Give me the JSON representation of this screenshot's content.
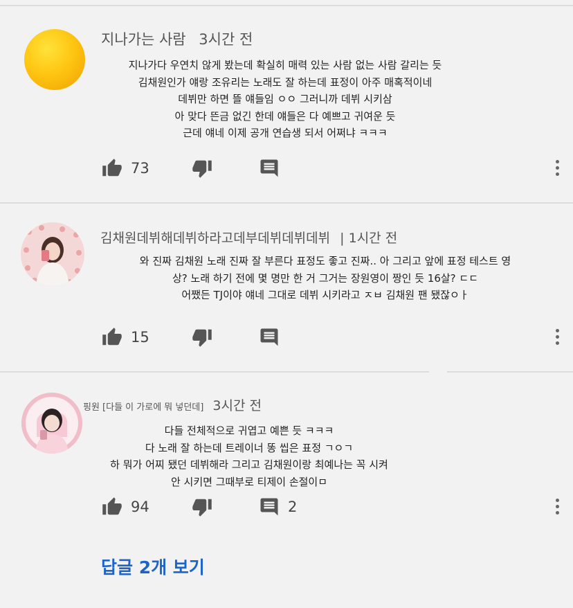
{
  "comments": [
    {
      "author": "지나가는 사람",
      "time": "3시간 전",
      "lines": [
        "지나가다 우연치 않게 봤는데 확실히 매력 있는 사람 없는 사람 갈리는 듯",
        "김채원인가 얘랑 조유리는 노래도 잘 하는데 표정이 아주 매혹적이네",
        "데뷔만 하면 뜰 얘들임 ㅇㅇ 그러니까 데뷔 시키삼",
        "아 맞다 뜬금 없긴 한데 얘들은 다 예쁘고 귀여운 듯",
        "근데 얘네 이제 공개 연습생 되서 어쩌냐 ㅋㅋㅋ"
      ],
      "likes": "73",
      "replies": "",
      "avatar": "yellow-circle-avatar"
    },
    {
      "author": "김채원데뷔해데뷔하라고데부데뷔데뷔데뷔",
      "time": "| 1시간 전",
      "lines": [
        "와 진짜 김채원 노래 진짜 잘 부른다 표정도 좋고 진짜.. 아 그리고 앞에 표정 테스트 영",
        "상? 노래 하기 전에 몇 명만 한 거 그거는 장원영이 짱인 듯 16살? ㄷㄷ",
        "어쨌든 TJ이야 얘네 그대로 데뷔 시키라고 ㅈㅂ 김채원 팬 됐잖ㅇㅏ"
      ],
      "likes": "15",
      "replies": "",
      "avatar": "photo-avatar"
    },
    {
      "author": "핑원 [다들 이 가로에 뭐 넣던데]",
      "time": "3시간 전",
      "lines": [
        "다들 전체적으로 귀엽고 예쁜 듯 ㅋㅋㅋ",
        "다 노래 잘 하는데 트레이너 똥 씹은 표정 ㄱㅇㄱ",
        "하 뭐가 어찌 됐던 데뷔해라 그리고 김채원이랑 최예나는 꼭 시켜",
        "안 시키면 그때부로 티제이 손절이ㅁ"
      ],
      "likes": "94",
      "replies": "2",
      "avatar": "photo-avatar"
    }
  ],
  "view_replies": "답글 2개 보기",
  "icons": [
    "thumbs-up-icon",
    "thumbs-down-icon",
    "reply-icon",
    "more-vert-icon"
  ],
  "colors": {
    "background": "#f2f2f2",
    "link": "#1e64c8",
    "icon": "#555555"
  }
}
